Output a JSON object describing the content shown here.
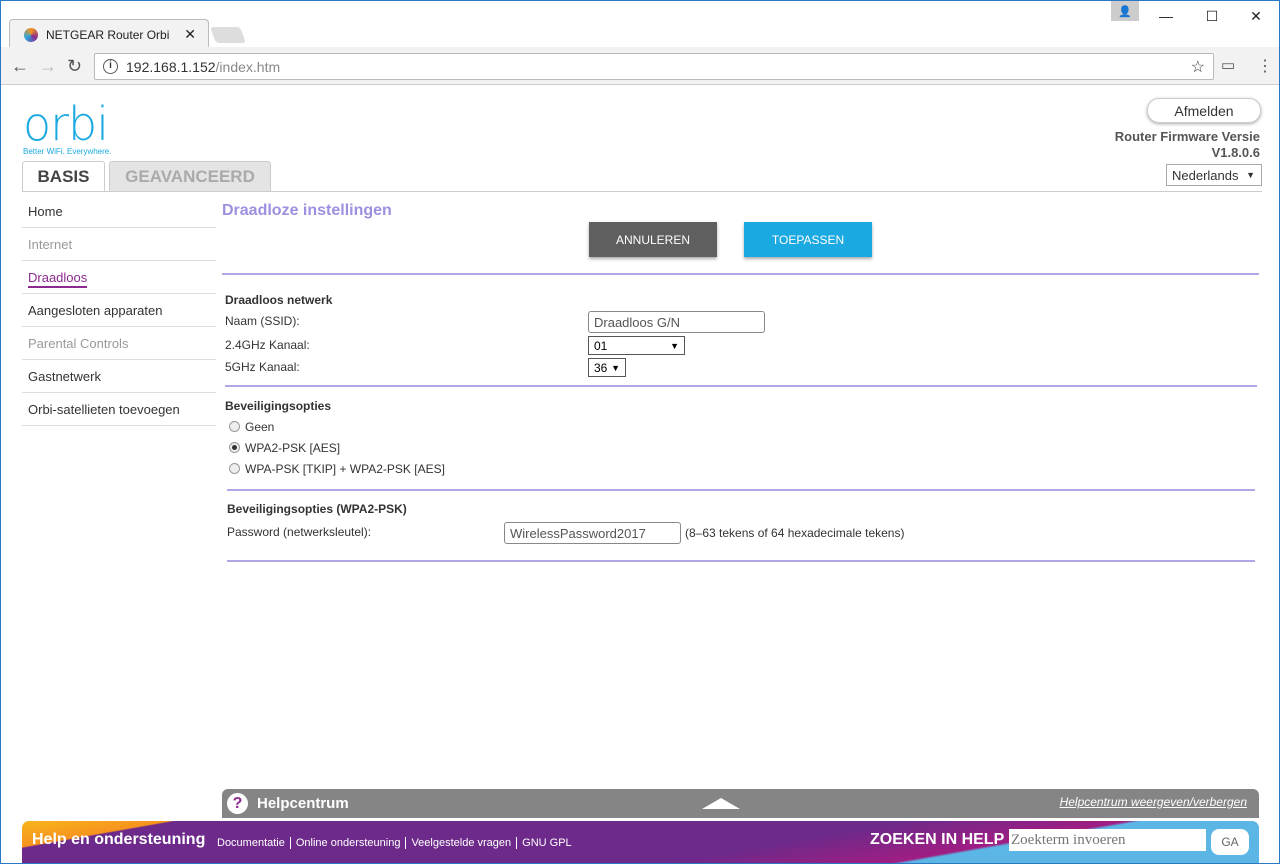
{
  "browser": {
    "tab_title": "NETGEAR Router Orbi",
    "url_host": "192.168.1.152",
    "url_path": "/index.htm"
  },
  "header": {
    "logo": "orbi",
    "tagline": "Better WiFi. Everywhere.",
    "logout": "Afmelden",
    "firmware_label": "Router Firmware Versie",
    "firmware_version": "V1.8.0.6",
    "language": "Nederlands",
    "tabs": [
      "BASIS",
      "GEAVANCEERD"
    ]
  },
  "sidebar": {
    "items": [
      {
        "label": "Home"
      },
      {
        "label": "Internet"
      },
      {
        "label": "Draadloos"
      },
      {
        "label": "Aangesloten apparaten"
      },
      {
        "label": "Parental Controls"
      },
      {
        "label": "Gastnetwerk"
      },
      {
        "label": "Orbi-satellieten toevoegen"
      }
    ]
  },
  "main": {
    "title": "Draadloze instellingen",
    "cancel": "ANNULEREN",
    "apply": "TOEPASSEN",
    "network": {
      "heading": "Draadloos netwerk",
      "ssid_label": "Naam (SSID):",
      "ssid_value": "Draadloos G/N",
      "ch24_label": "2.4GHz Kanaal:",
      "ch24_value": "01",
      "ch5_label": "5GHz Kanaal:",
      "ch5_value": "36"
    },
    "security": {
      "heading": "Beveiligingsopties",
      "options": [
        "Geen",
        "WPA2-PSK [AES]",
        "WPA-PSK [TKIP] + WPA2-PSK [AES]"
      ],
      "selected": 1
    },
    "wpa": {
      "heading": "Beveiligingsopties (WPA2-PSK)",
      "password_label": "Password (netwerksleutel):",
      "password_value": "WirelessPassword2017",
      "hint": "(8–63 tekens of 64 hexadecimale tekens)"
    }
  },
  "helpbar": {
    "title": "Helpcentrum",
    "toggle": "Helpcentrum weergeven/verbergen"
  },
  "footer": {
    "title": "Help en ondersteuning",
    "links": [
      "Documentatie",
      "Online ondersteuning",
      "Veelgestelde vragen",
      "GNU GPL"
    ],
    "search_label": "ZOEKEN IN HELP",
    "search_placeholder": "Zoekterm invoeren",
    "go": "GA"
  }
}
